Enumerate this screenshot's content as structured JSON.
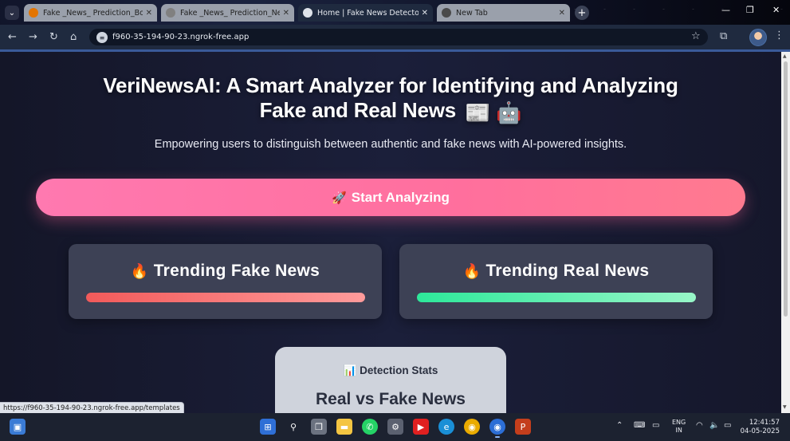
{
  "browser": {
    "tabs": [
      {
        "title": "Fake _News_ Prediction_Bot - C",
        "active": false,
        "favicon_color": "#e37400"
      },
      {
        "title": "Fake _News_ Prediction_NewOr",
        "active": false,
        "favicon_color": "#808080"
      },
      {
        "title": "Home | Fake News Detector",
        "active": true,
        "favicon_color": "#dfe3ea"
      },
      {
        "title": "New Tab",
        "active": false,
        "favicon_color": "#4a4a4a"
      }
    ],
    "url": "f960-35-194-90-23.ngrok-free.app",
    "status_url": "https://f960-35-194-90-23.ngrok-free.app/templates"
  },
  "hero": {
    "title_line1": "VeriNewsAI: A Smart Analyzer for Identifying and Analyzing",
    "title_line2": "Fake and Real News",
    "title_emojis": "📰 🤖",
    "subtitle": "Empowering users to distinguish between authentic and fake news with AI-powered insights."
  },
  "cta": {
    "icon": "🚀",
    "label": "Start Analyzing"
  },
  "cards": [
    {
      "icon": "🔥",
      "label": "Trending Fake News",
      "bar_color_start": "#f25a5a",
      "bar_color_end": "#ff9b9b"
    },
    {
      "icon": "🔥",
      "label": "Trending Real News",
      "bar_color_start": "#2de89a",
      "bar_color_end": "#98f6c8"
    }
  ],
  "stats": {
    "icon": "📊",
    "header": "Detection Stats",
    "subheader": "Real vs Fake News"
  },
  "taskbar": {
    "language": "ENG",
    "region": "IN",
    "time": "12:41:57",
    "date": "04-05-2025"
  }
}
